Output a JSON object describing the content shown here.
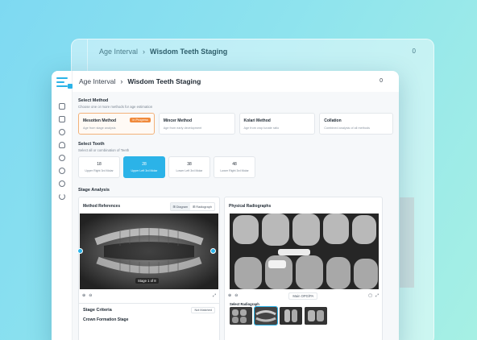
{
  "ghost": {
    "breadcrumb_parent": "Age Interval",
    "breadcrumb_current": "Wisdom Teeth Staging",
    "counter": "0"
  },
  "header": {
    "breadcrumb_parent": "Age Interval",
    "breadcrumb_sep": "›",
    "breadcrumb_current": "Wisdom Teeth Staging",
    "counter": "0"
  },
  "select_method": {
    "title": "Select Method",
    "subtitle": "Choose one or more methods for age estimation",
    "methods": [
      {
        "name": "Mesotten Method",
        "desc": "Age from stage analysis",
        "badge": "In Progress"
      },
      {
        "name": "Mincer Method",
        "desc": "Age from early development"
      },
      {
        "name": "Kolari Method",
        "desc": "Age from crop lunate ratio"
      },
      {
        "name": "Collation",
        "desc": "Combined analysis of all methods"
      }
    ]
  },
  "select_tooth": {
    "title": "Select Tooth",
    "subtitle": "Select all or combination of Teeth",
    "teeth": [
      {
        "num": "18",
        "label": "Upper Right 3rd Molar"
      },
      {
        "num": "28",
        "label": "Upper Left 3rd Molar"
      },
      {
        "num": "38",
        "label": "Lower Left 3rd Molar"
      },
      {
        "num": "48",
        "label": "Lower Right 3rd Molar"
      }
    ]
  },
  "stage_analysis": {
    "title": "Stage Analysis",
    "method_references": {
      "title": "Method References",
      "toggle": [
        "⊞ Diagram",
        "⊞ Radiograph"
      ],
      "stage_chip": "Stage 1 of 8"
    },
    "physical_radiographs": {
      "title": "Physical Radiographs",
      "footer_label": "Main OPG/PA",
      "select_label": "Select Radiograph"
    },
    "criteria": {
      "title": "Stage Criteria",
      "status": "Not Matched",
      "heading": "Crown Formation Stage"
    }
  },
  "icons": {
    "zoom_in": "⊕",
    "zoom_out": "⊖",
    "fullscreen": "⤢",
    "crop": "▢"
  },
  "colors": {
    "accent": "#2bb3e8",
    "badge": "#f08a3c"
  }
}
